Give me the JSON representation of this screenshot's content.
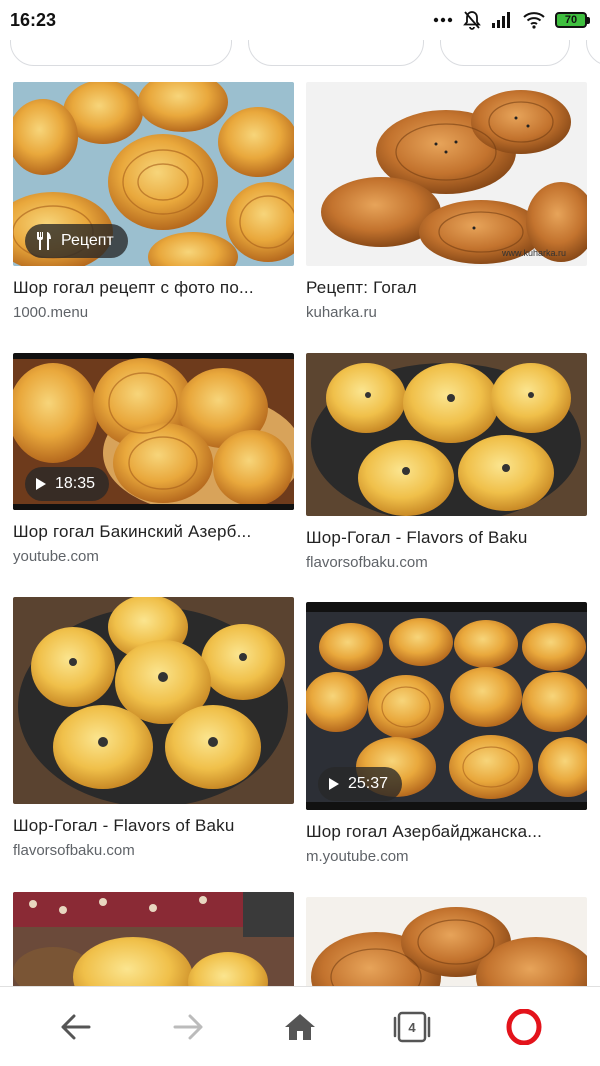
{
  "status_bar": {
    "time": "16:23",
    "battery": "70",
    "icons": [
      "more-dots-icon",
      "muted-bell-icon",
      "signal-icon",
      "wifi-icon",
      "battery-icon"
    ]
  },
  "results": [
    {
      "title": "Шор гогал рецепт с фото по...",
      "source": "1000.menu",
      "badge": "Рецепт",
      "badge_icon": "fork-knife-icon"
    },
    {
      "title": "Рецепт: Гогал",
      "source": "kuharka.ru",
      "watermark": "www.kuharka.ru"
    },
    {
      "title": "Шор гогал Бакинский Азерб...",
      "source": "youtube.com",
      "badge": "18:35",
      "badge_icon": "play-icon"
    },
    {
      "title": "Шор-Гогал - Flavors of Baku",
      "source": "flavorsofbaku.com"
    },
    {
      "title": "Шор-Гогал - Flavors of Baku",
      "source": "flavorsofbaku.com"
    },
    {
      "title": "Шор гогал Азербайджанска...",
      "source": "m.youtube.com",
      "badge": "25:37",
      "badge_icon": "play-icon"
    }
  ],
  "bottom_nav": {
    "tabs_count": "4",
    "items": [
      "back-arrow-icon",
      "forward-arrow-icon",
      "home-icon",
      "tabs-icon",
      "opera-menu-icon"
    ]
  },
  "colors": {
    "accent_opera": "#e3131b",
    "text_primary": "#222222",
    "text_secondary": "#5f6368",
    "chip_border": "#dadce0"
  }
}
